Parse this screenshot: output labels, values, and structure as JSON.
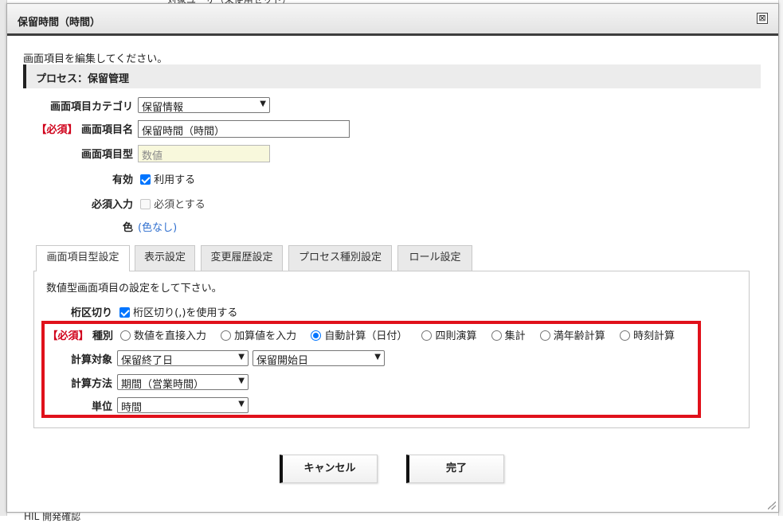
{
  "background": {
    "top_text": "対象ユーザ（未使用セット）",
    "bottom_text": "HIL 開発確認"
  },
  "dialog": {
    "title": "保留時間（時間）",
    "close_symbol": "⊠",
    "intro": "画面項目を編集してください。",
    "process_label": "プロセス：保留管理"
  },
  "form": {
    "category_label": "画面項目カテゴリ",
    "category_value": "保留情報",
    "required_tag": "【必須】",
    "name_label": "画面項目名",
    "name_value": "保留時間（時間）",
    "type_label": "画面項目型",
    "type_value": "数値",
    "enabled_label": "有効",
    "enabled_checked": true,
    "enabled_text": "利用する",
    "required_input_label": "必須入力",
    "required_input_checked": false,
    "required_input_text": "必須とする",
    "color_label": "色",
    "color_value": "(色なし)"
  },
  "tabs": [
    {
      "label": "画面項目型設定",
      "active": true
    },
    {
      "label": "表示設定",
      "active": false
    },
    {
      "label": "変更履歴設定",
      "active": false
    },
    {
      "label": "プロセス種別設定",
      "active": false
    },
    {
      "label": "ロール設定",
      "active": false
    }
  ],
  "panel": {
    "intro": "数値型画面項目の設定をして下さい。",
    "separator_label": "桁区切り",
    "separator_checked": true,
    "separator_text": "桁区切り(,)を使用する",
    "required_tag": "【必須】",
    "kind_label": "種別",
    "kind_options": [
      {
        "label": "数値を直接入力",
        "checked": false
      },
      {
        "label": "加算値を入力",
        "checked": false
      },
      {
        "label": "自動計算（日付）",
        "checked": true
      },
      {
        "label": "四則演算",
        "checked": false
      },
      {
        "label": "集計",
        "checked": false
      },
      {
        "label": "満年齢計算",
        "checked": false
      },
      {
        "label": "時刻計算",
        "checked": false
      }
    ],
    "target_label": "計算対象",
    "target_from": "保留終了日",
    "target_to": "保留開始日",
    "method_label": "計算方法",
    "method_value": "期間（営業時間）",
    "unit_label": "単位",
    "unit_value": "時間"
  },
  "buttons": {
    "cancel": "キャンセル",
    "done": "完了"
  },
  "colors": {
    "highlight": "#e0111b",
    "required": "#d0021b",
    "link": "#2f6fcf",
    "check_accent": "#0075ff"
  }
}
